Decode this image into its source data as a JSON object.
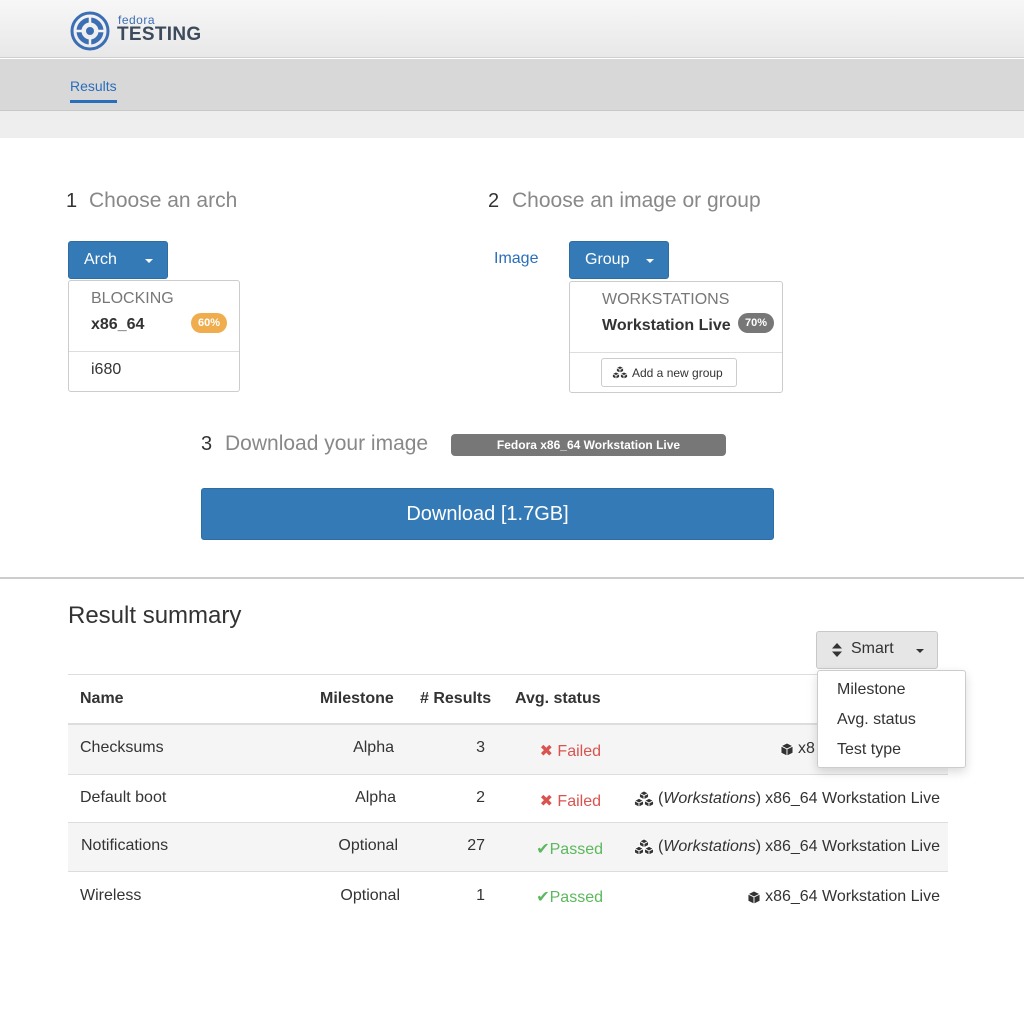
{
  "header": {
    "logo_small": "fedora",
    "logo_big": "TESTING"
  },
  "nav": {
    "results": "Results"
  },
  "step1": {
    "num": "1",
    "title": "Choose an arch",
    "button_label": "Arch",
    "section_header": "BLOCKING",
    "items": [
      {
        "label": "x86_64",
        "badge": "60%",
        "badge_color": "#f0ad4e"
      },
      {
        "label": "i680"
      }
    ]
  },
  "step2": {
    "num": "2",
    "title": "Choose an image or group",
    "image_link": "Image",
    "button_label": "Group",
    "section_header": "WORKSTATIONS",
    "items": [
      {
        "label": "Workstation Live",
        "badge": "70%",
        "badge_color": "#777777"
      }
    ],
    "add_group": "Add a new group"
  },
  "step3": {
    "num": "3",
    "title": "Download your image",
    "selected_label": "Fedora x86_64 Workstation Live",
    "download_button": "Download [1.7GB]"
  },
  "summary": {
    "title": "Result summary",
    "sort_button": "Smart",
    "sort_options": [
      "Milestone",
      "Avg. status",
      "Test type"
    ],
    "columns": [
      "Name",
      "Milestone",
      "# Results",
      "Avg. status"
    ],
    "rows": [
      {
        "name": "Checksums",
        "milestone": "Alpha",
        "results": "3",
        "status": "Failed",
        "status_type": "failed",
        "image_icon": "cube-icon",
        "image_group": "",
        "image": "x8"
      },
      {
        "name": "Default boot",
        "milestone": "Alpha",
        "results": "2",
        "status": "Failed",
        "status_type": "failed",
        "image_icon": "cubes-icon",
        "image_group": "Workstations",
        "image": "x86_64 Workstation Live"
      },
      {
        "name": "Notifications",
        "milestone": "Optional",
        "results": "27",
        "status": "Passed",
        "status_type": "passed",
        "image_icon": "cubes-icon",
        "image_group": "Workstations",
        "image": "x86_64 Workstation Live"
      },
      {
        "name": "Wireless",
        "milestone": "Optional",
        "results": "1",
        "status": "Passed",
        "status_type": "passed",
        "image_icon": "cube-icon",
        "image_group": "",
        "image": "x86_64 Workstation Live"
      }
    ]
  },
  "colors": {
    "primary": "#337ab7",
    "link": "#2a6ebb",
    "failed": "#d9534f",
    "passed": "#5cb85c",
    "warning_badge": "#f0ad4e",
    "gray_badge": "#777777"
  }
}
